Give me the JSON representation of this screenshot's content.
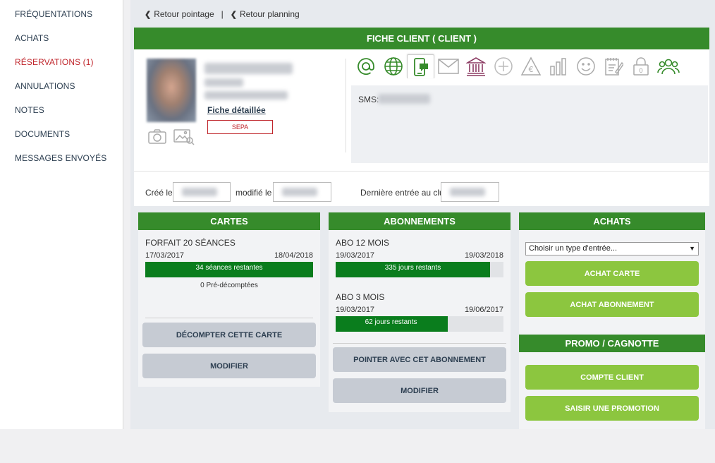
{
  "sidebar": {
    "items": [
      {
        "label": "FRÉQUENTATIONS"
      },
      {
        "label": "ACHATS"
      },
      {
        "label": "RÉSERVATIONS (1)"
      },
      {
        "label": "ANNULATIONS"
      },
      {
        "label": "NOTES"
      },
      {
        "label": "DOCUMENTS"
      },
      {
        "label": "MESSAGES ENVOYÉS"
      }
    ]
  },
  "nav": {
    "back_pointage": "Retour pointage",
    "separator": "|",
    "back_planning": "Retour planning"
  },
  "fiche": {
    "title": "FICHE CLIENT ( CLIENT )",
    "detail_link": "Fiche détaillée",
    "sepa": "SEPA",
    "sms_label": "SMS:",
    "created_label": "Créé le",
    "modified_label": "modifié le",
    "last_entry_label": "Dernière entrée au club",
    "icons": [
      "at-icon",
      "globe-icon",
      "mobile-sms-icon",
      "envelope-icon",
      "bank-icon",
      "plus-circle-icon",
      "euro-triangle-icon",
      "bar-chart-icon",
      "smiley-icon",
      "notepad-icon",
      "lock-icon",
      "group-icon"
    ]
  },
  "cartes": {
    "header": "CARTES",
    "card": {
      "title": "FORFAIT 20 SÉANCES",
      "start": "17/03/2017",
      "end": "18/04/2018",
      "remaining": "34 séances restantes",
      "progress": 1.0,
      "precount": "0 Pré-décomptées"
    },
    "btn_decount": "DÉCOMPTER CETTE CARTE",
    "btn_modify": "MODIFIER"
  },
  "abonnements": {
    "header": "ABONNEMENTS",
    "items": [
      {
        "title": "ABO 12 MOIS",
        "start": "19/03/2017",
        "end": "19/03/2018",
        "remaining": "335 jours restants",
        "progress": 0.92
      },
      {
        "title": "ABO 3 MOIS",
        "start": "19/03/2017",
        "end": "19/06/2017",
        "remaining": "62 jours restants",
        "progress": 0.67
      }
    ],
    "btn_point": "POINTER AVEC CET ABONNEMENT",
    "btn_modify": "MODIFIER"
  },
  "achats": {
    "header": "ACHATS",
    "select_value": "Choisir un type d'entrée...",
    "btn_carte": "ACHAT CARTE",
    "btn_abonnement": "ACHAT ABONNEMENT"
  },
  "promo": {
    "header": "PROMO / CAGNOTTE",
    "btn_compte": "COMPTE CLIENT",
    "btn_promo": "SAISIR UNE PROMOTION"
  },
  "colors": {
    "green_header": "#368b2b",
    "progress_green": "#0a7d1d",
    "light_green_button": "#8cc63f",
    "red_text": "#c0262c"
  }
}
